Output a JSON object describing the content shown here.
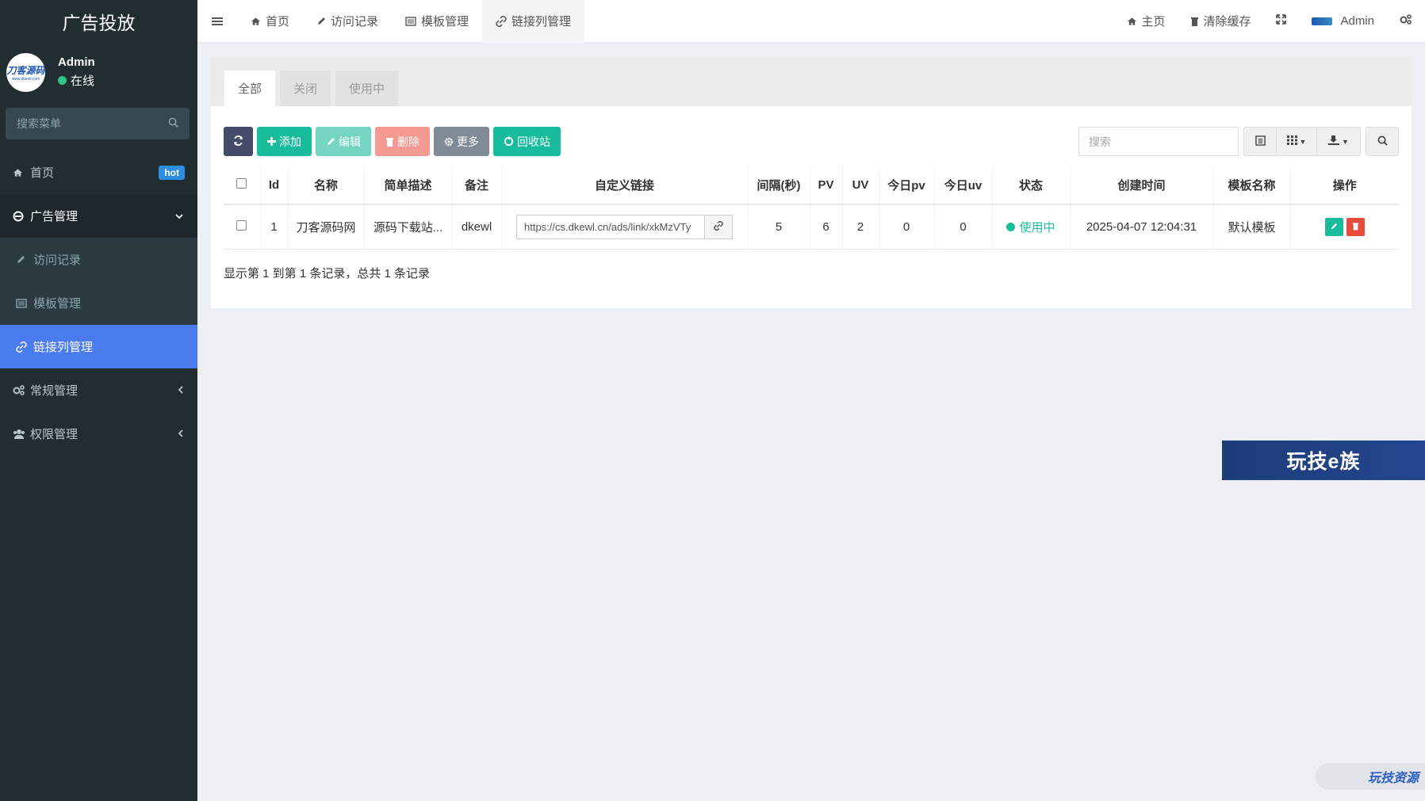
{
  "sidebar": {
    "brand": "广告投放",
    "avatar_text": "刀客源码",
    "avatar_sub": "www.dkewl.com",
    "user_name": "Admin",
    "user_status": "在线",
    "search_placeholder": "搜索菜单",
    "items": [
      {
        "label": "首页",
        "badge": "hot"
      },
      {
        "label": "广告管理"
      },
      {
        "label": "常规管理"
      },
      {
        "label": "权限管理"
      }
    ],
    "sub_items": [
      {
        "label": "访问记录"
      },
      {
        "label": "模板管理"
      },
      {
        "label": "链接列管理"
      }
    ]
  },
  "navbar": {
    "tabs": [
      {
        "label": "首页"
      },
      {
        "label": "访问记录"
      },
      {
        "label": "模板管理"
      },
      {
        "label": "链接列管理"
      }
    ],
    "home_label": "主页",
    "clear_cache_label": "清除缓存",
    "user_label": "Admin"
  },
  "content": {
    "tabs": [
      {
        "label": "全部"
      },
      {
        "label": "关闭"
      },
      {
        "label": "使用中"
      }
    ],
    "toolbar": {
      "add_label": "添加",
      "edit_label": "编辑",
      "delete_label": "删除",
      "more_label": "更多",
      "recycle_label": "回收站"
    },
    "search_placeholder": "搜索",
    "table": {
      "headers": [
        "Id",
        "名称",
        "简单描述",
        "备注",
        "自定义链接",
        "间隔(秒)",
        "PV",
        "UV",
        "今日pv",
        "今日uv",
        "状态",
        "创建时间",
        "模板名称",
        "操作"
      ],
      "rows": [
        {
          "id": "1",
          "name": "刀客源码网",
          "desc": "源码下载站...",
          "remark": "dkewl",
          "link": "https://cs.dkewl.cn/ads/link/xkMzVTy",
          "interval": "5",
          "pv": "6",
          "uv": "2",
          "today_pv": "0",
          "today_uv": "0",
          "status": "使用中",
          "created": "2025-04-07 12:04:31",
          "template": "默认模板"
        }
      ]
    },
    "pagination_info": "显示第 1 到第 1 条记录，总共 1 条记录"
  },
  "overlays": {
    "banner": "玩技e族",
    "corner": "玩技资源"
  },
  "colors": {
    "sidebar_bg": "#222d32",
    "active_menu": "#4a7cf0",
    "success": "#18bc9c",
    "danger": "#e74c3c",
    "badge": "#2b8ee0"
  }
}
